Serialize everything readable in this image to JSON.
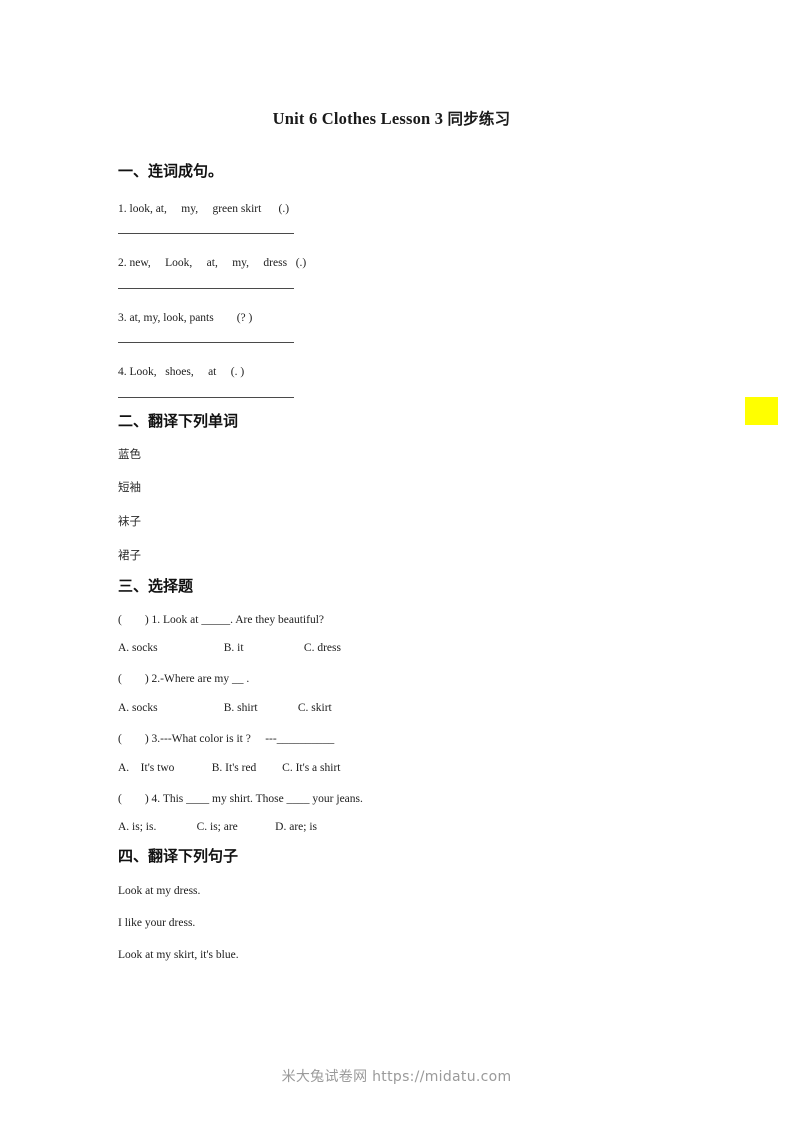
{
  "document": {
    "title_en": "Unit 6 Clothes Lesson 3 ",
    "title_cn": "同步练习"
  },
  "section1": {
    "heading": "一、连词成句。",
    "items": [
      "1. look, at,     my,     green skirt      (.)",
      "2. new,     Look,     at,     my,     dress   (.)",
      "3. at, my, look, pants        (? )",
      "4. Look,   shoes,     at     (. )"
    ]
  },
  "section2": {
    "heading": "二、翻译下列单词",
    "words": [
      "蓝色",
      "短袖",
      "袜子",
      "裙子"
    ]
  },
  "section3": {
    "heading": "三、选择题",
    "questions": [
      {
        "stem": "(        ) 1. Look at _____. Are they beautiful?",
        "options": "A. socks                       B. it                     C. dress"
      },
      {
        "stem": "(        ) 2.-Where are my __ .",
        "options": "A. socks                       B. shirt              C. skirt"
      },
      {
        "stem": "(        ) 3.---What color is it ?     ---__________",
        "options": "A.    It's two             B. It's red         C. It's a shirt"
      },
      {
        "stem": "(        ) 4. This ____ my shirt. Those ____ your jeans.",
        "options": "A. is; is.              C. is; are             D. are; is"
      }
    ]
  },
  "section4": {
    "heading": "四、翻译下列句子",
    "sentences": [
      "Look at my dress.",
      "I like your dress.",
      "Look at my skirt, it's blue."
    ]
  },
  "footer": {
    "watermark": "米大兔试卷网 https://midatu.com"
  },
  "annotations": {
    "highlight_color": "#ffff00"
  }
}
